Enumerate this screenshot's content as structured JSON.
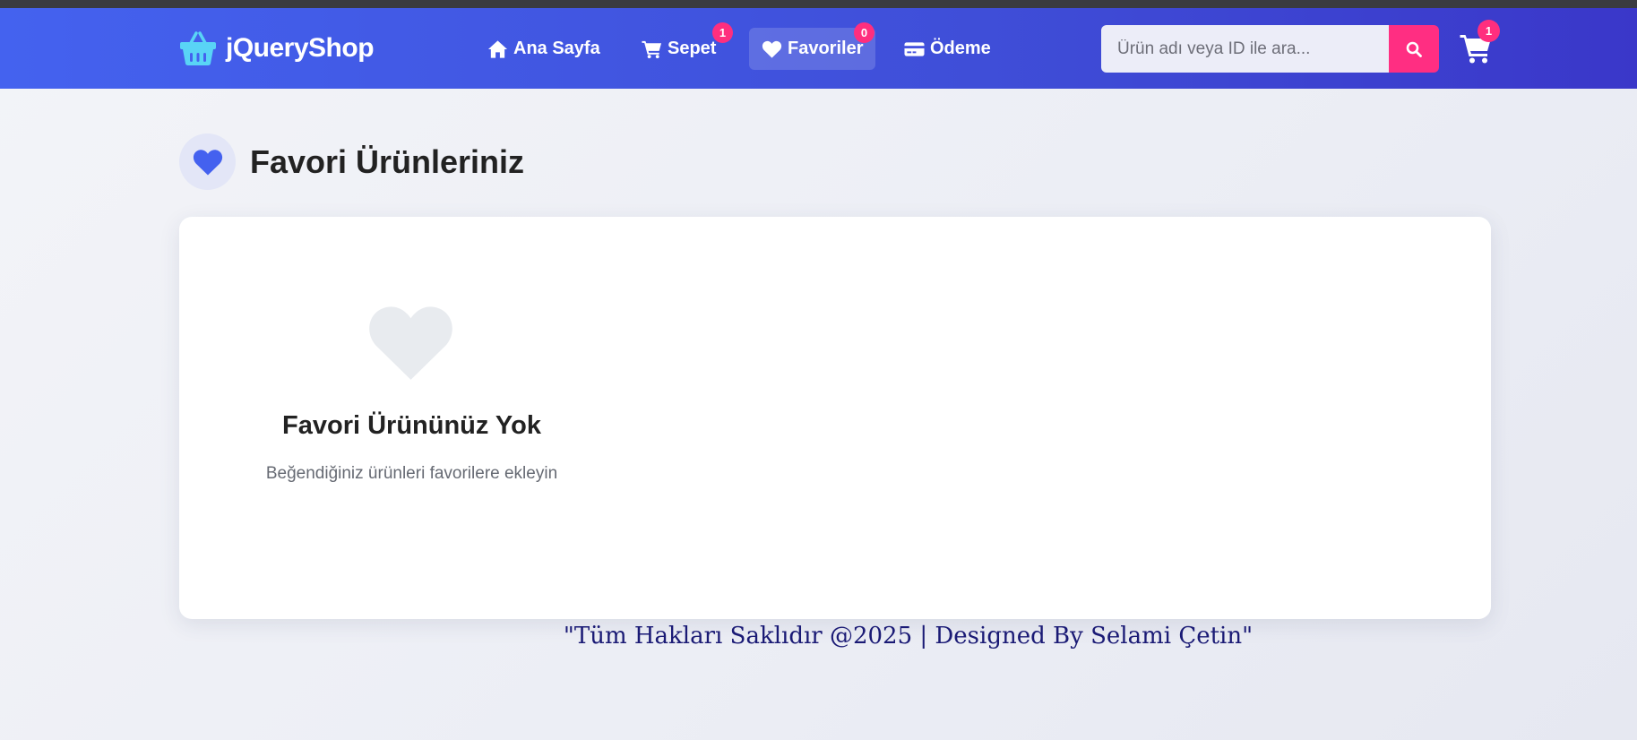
{
  "brand": {
    "name": "jQueryShop",
    "icon": "shopping-basket-icon",
    "icon_color": "#59d4f6"
  },
  "nav": {
    "home": {
      "label": "Ana Sayfa",
      "icon": "home-icon"
    },
    "cart": {
      "label": "Sepet",
      "icon": "cart-icon",
      "badge": "1"
    },
    "favorites": {
      "label": "Favoriler",
      "icon": "heart-icon",
      "badge": "0",
      "active": true
    },
    "checkout": {
      "label": "Ödeme",
      "icon": "credit-card-icon"
    }
  },
  "search": {
    "placeholder": "Ürün adı veya ID ile ara...",
    "button_icon": "search-icon"
  },
  "header_cart": {
    "icon": "cart-icon",
    "badge": "1"
  },
  "page": {
    "title": "Favori Ürünleriniz",
    "title_icon": "heart-icon"
  },
  "empty_state": {
    "icon": "heart-icon",
    "title": "Favori Ürününüz Yok",
    "description": "Beğendiğiniz ürünleri favorilere ekleyin"
  },
  "footer": {
    "text": "\"Tüm Hakları Saklıdır @2025 | Designed By Selami Çetin\""
  },
  "colors": {
    "navbar": "#4059e6",
    "accent": "#ff2e82",
    "heading_icon": "#4461ef"
  }
}
